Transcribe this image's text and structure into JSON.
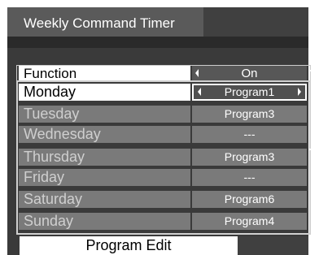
{
  "window": {
    "title": "Weekly Command Timer"
  },
  "function_row": {
    "label": "Function",
    "value": "On"
  },
  "days": [
    {
      "day": "Monday",
      "program": "Program1",
      "selected": true
    },
    {
      "day": "Tuesday",
      "program": "Program3",
      "selected": false
    },
    {
      "day": "Wednesday",
      "program": "---",
      "selected": false
    },
    {
      "day": "Thursday",
      "program": "Program3",
      "selected": false
    },
    {
      "day": "Friday",
      "program": "---",
      "selected": false
    },
    {
      "day": "Saturday",
      "program": "Program6",
      "selected": false
    },
    {
      "day": "Sunday",
      "program": "Program4",
      "selected": false
    }
  ],
  "program_edit": {
    "label": "Program Edit"
  },
  "colors": {
    "background": "#3a3a3a",
    "row": "#7a7a7a",
    "highlight": "#ffffff",
    "value_box": "#505050"
  }
}
